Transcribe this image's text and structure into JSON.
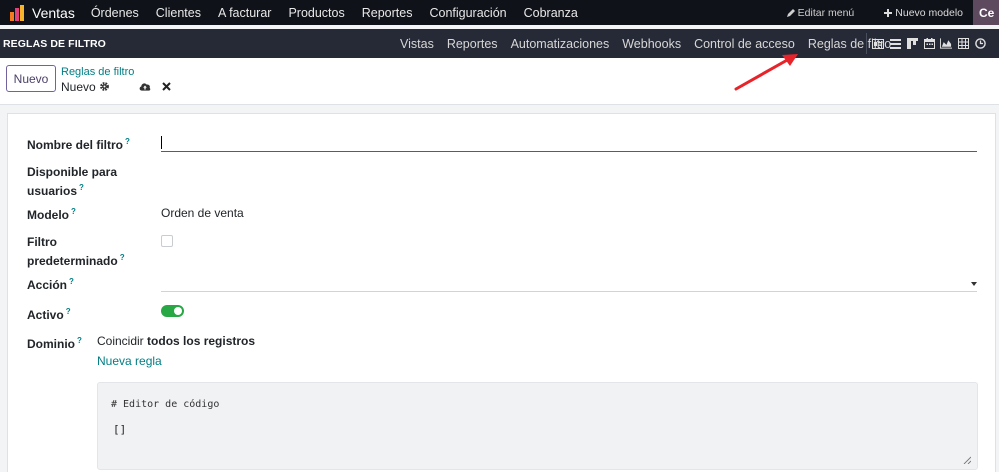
{
  "topbar": {
    "app_name": "Ventas",
    "menu": [
      "Órdenes",
      "Clientes",
      "A facturar",
      "Productos",
      "Reportes",
      "Configuración",
      "Cobranza"
    ],
    "edit_menu": "Editar menú",
    "new_model": "Nuevo modelo",
    "avatar_text": "Ce"
  },
  "subbar": {
    "title": "REGLAS DE FILTRO",
    "menu": [
      "Vistas",
      "Reportes",
      "Automatizaciones",
      "Webhooks",
      "Control de acceso",
      "Reglas de filtro"
    ],
    "view_icons": [
      "form-view-icon",
      "list-view-icon",
      "kanban-view-icon",
      "calendar-view-icon",
      "graph-view-icon",
      "pivot-view-icon",
      "activity-view-icon"
    ]
  },
  "control": {
    "new_button": "Nuevo",
    "breadcrumb": "Reglas de filtro",
    "record_name": "Nuevo"
  },
  "form": {
    "name_label": "Nombre del filtro",
    "name_value": "",
    "available_label_1": "Disponible para",
    "available_label_2": "usuarios",
    "model_label": "Modelo",
    "model_value": "Orden de venta",
    "default_label_1": "Filtro",
    "default_label_2": "predeterminado",
    "default_checked": false,
    "action_label": "Acción",
    "action_value": "",
    "active_label": "Activo",
    "active_on": true,
    "domain_label": "Dominio",
    "domain_prefix": "Coincidir",
    "domain_strong": "todos los registros",
    "new_rule": "Nueva regla",
    "code_comment": "# Editor de código",
    "code_value": "[]",
    "help_mark": "?"
  },
  "colors": {
    "topbar_bg": "#0f1218",
    "subbar_bg": "#262a36",
    "link": "#017e84",
    "primary": "#71639e",
    "toggle_on": "#28a745",
    "annotation_arrow": "#e8232a"
  }
}
